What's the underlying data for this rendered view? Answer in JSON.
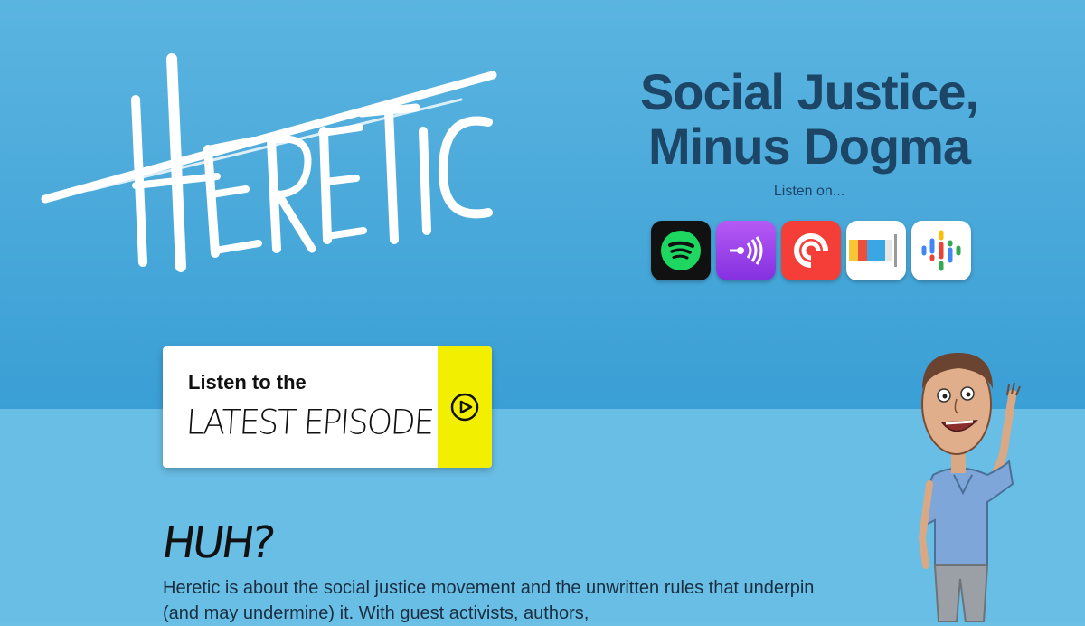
{
  "logo": {
    "text": "HERETIC"
  },
  "hero": {
    "headline_line1": "Social Justice,",
    "headline_line2": "Minus Dogma",
    "listen_on": "Listen on..."
  },
  "platforms": [
    {
      "name": "Spotify",
      "icon": "spotify-icon"
    },
    {
      "name": "Apple Podcasts",
      "icon": "apple-podcasts-icon"
    },
    {
      "name": "Pocket Casts",
      "icon": "pocket-casts-icon"
    },
    {
      "name": "Castbox",
      "icon": "castbox-icon"
    },
    {
      "name": "Google Podcasts",
      "icon": "google-podcasts-icon"
    }
  ],
  "card": {
    "title": "Listen to the",
    "script": "LATEST EPISODE",
    "play_icon": "play-icon",
    "accent": "#f2ef00"
  },
  "about": {
    "heading": "HUH?",
    "text": "Heretic is about the social justice movement and the unwritten rules that underpin (and may undermine) it. With guest activists, authors,"
  },
  "colors": {
    "hero_bg": "#3a9fd5",
    "lower_bg": "#69bee6",
    "headline": "#1c4566"
  }
}
